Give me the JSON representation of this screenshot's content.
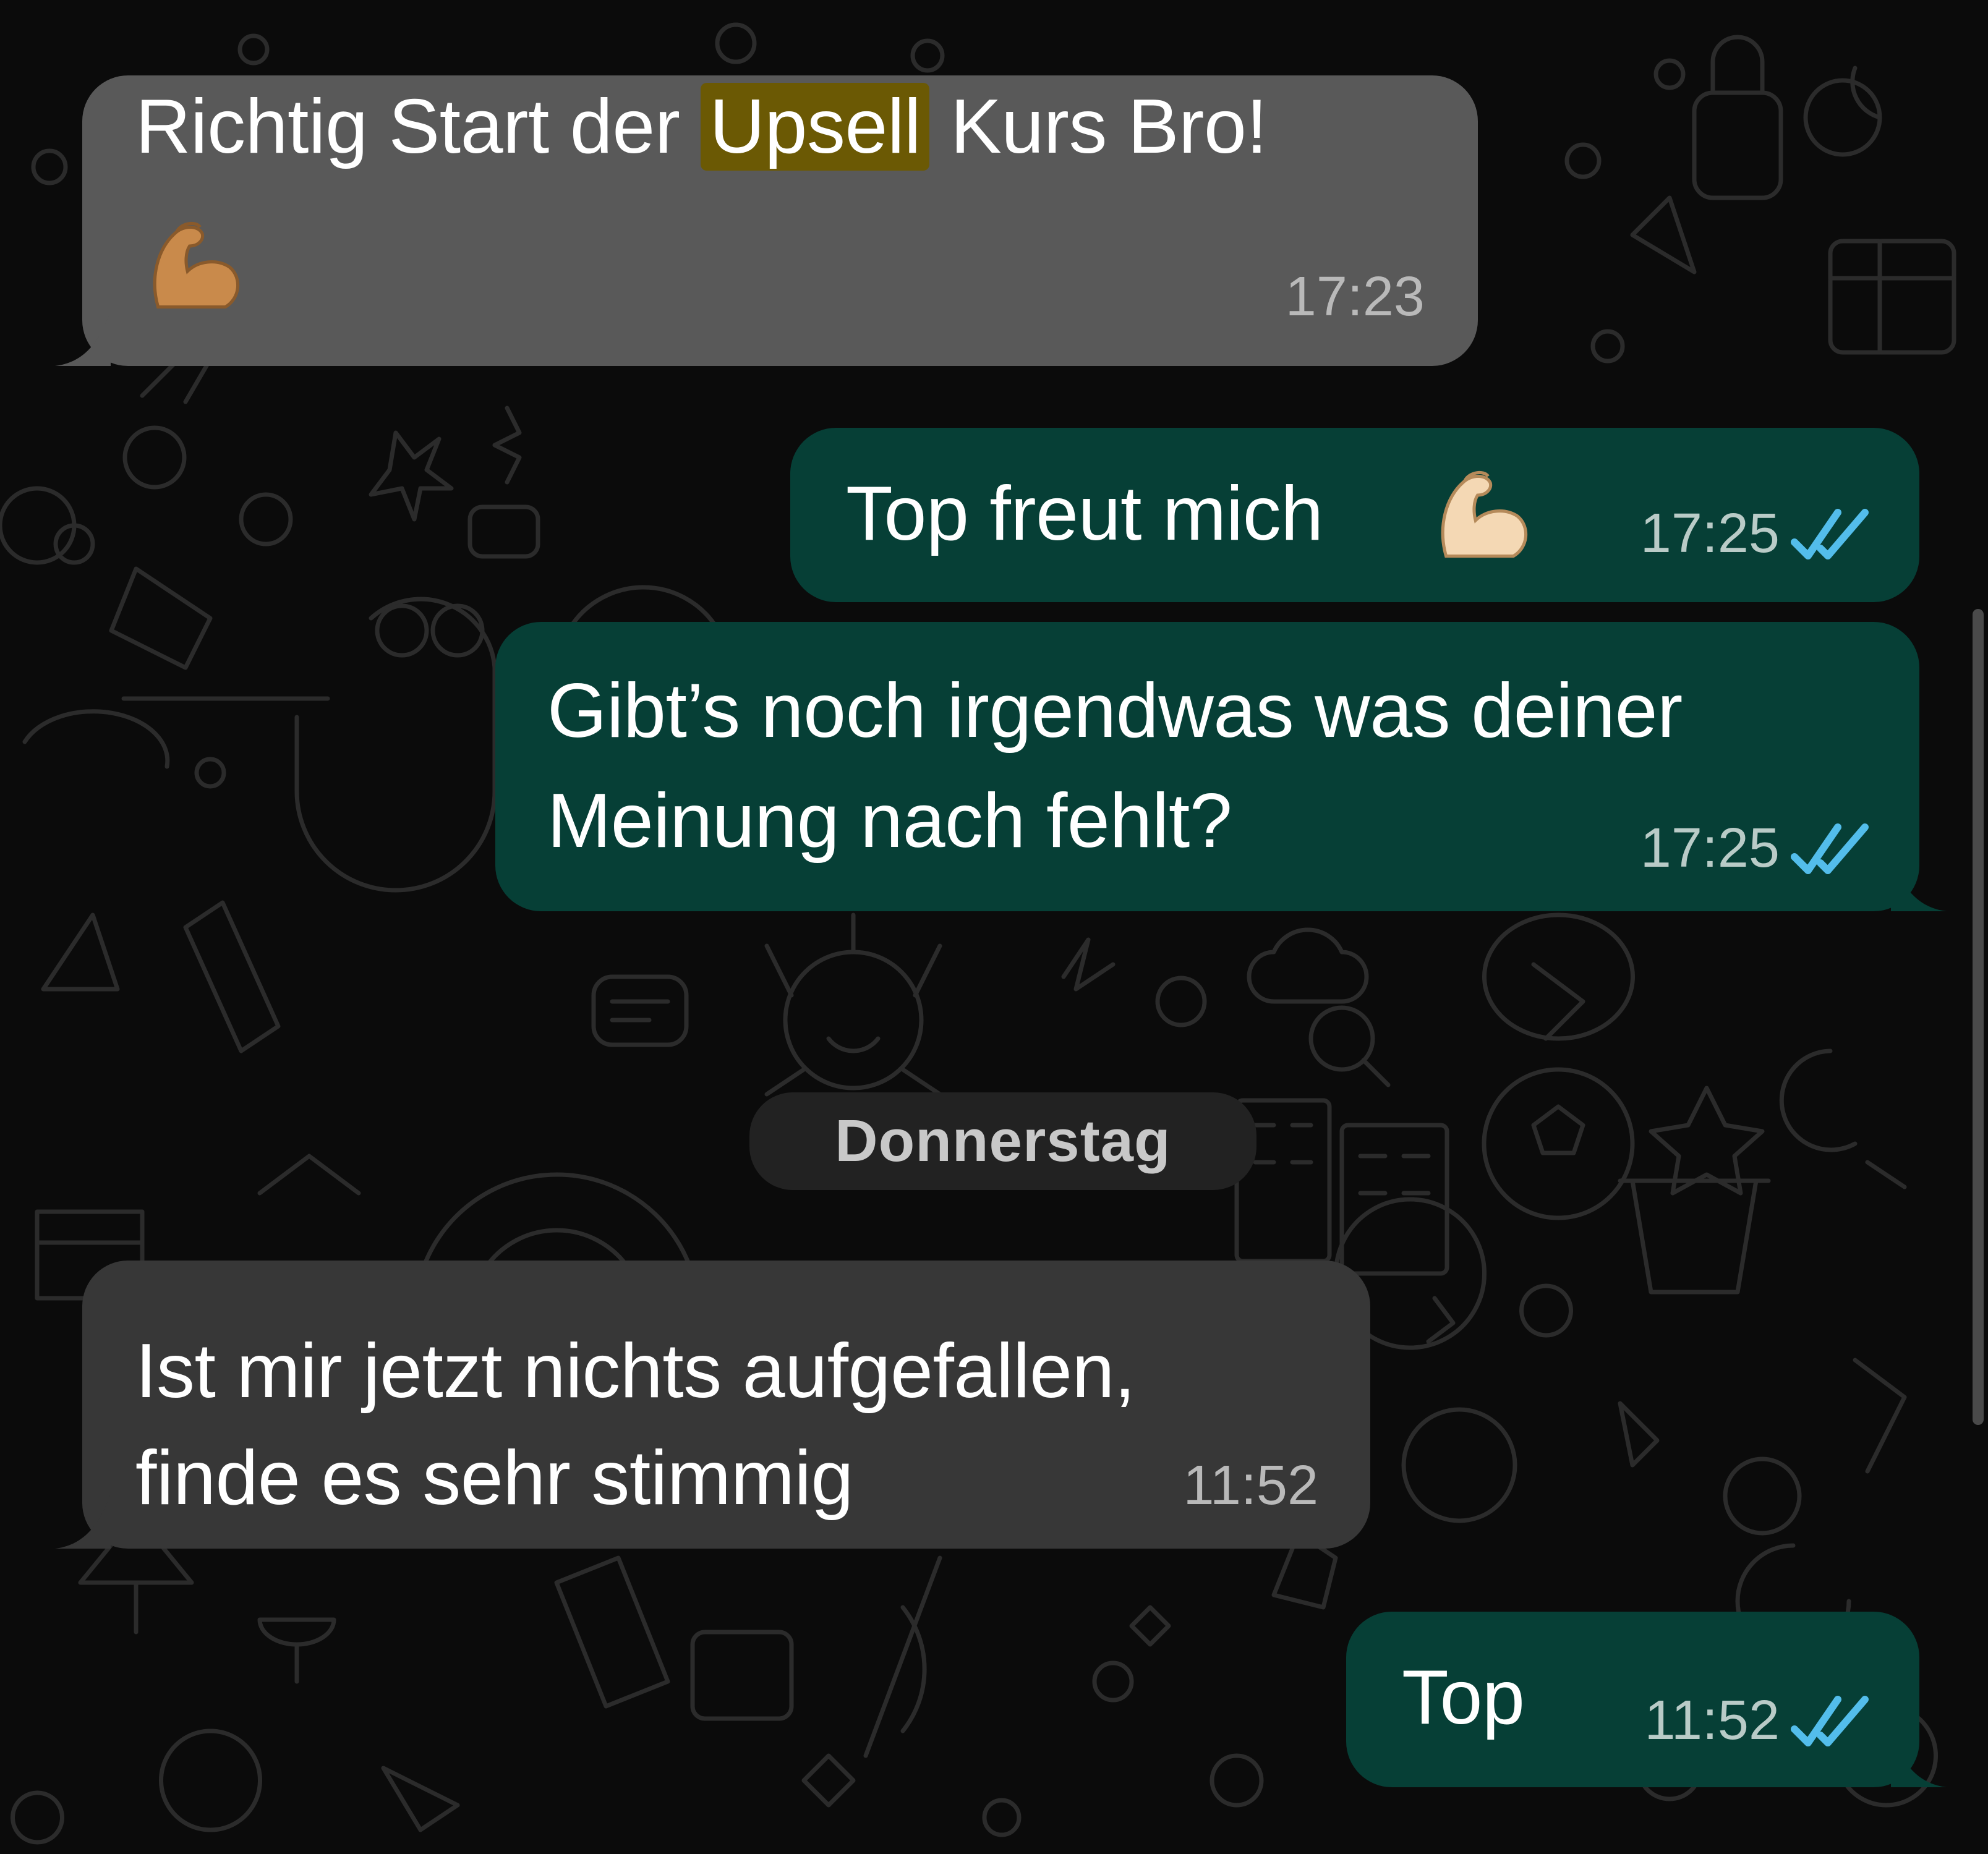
{
  "chat": {
    "messages": [
      {
        "direction": "incoming",
        "text_before": "Richtig Start der ",
        "highlight": "Upsell",
        "text_after": " Kurs Bro!",
        "emoji": "flexed-biceps-medium-skin",
        "time": "17:23"
      },
      {
        "direction": "outgoing",
        "text": "Top freut mich",
        "emoji": "flexed-biceps-light-skin",
        "time": "17:25",
        "status": "read"
      },
      {
        "direction": "outgoing",
        "lines": [
          "Gibt’s noch irgendwas was deiner",
          "Meinung nach fehlt?"
        ],
        "time": "17:25",
        "status": "read"
      },
      {
        "direction": "incoming",
        "lines": [
          "Ist mir jetzt nichts aufgefallen,",
          "finde es sehr stimmig"
        ],
        "time": "11:52"
      },
      {
        "direction": "outgoing",
        "text": "Top",
        "time": "11:52",
        "status": "read"
      }
    ],
    "date_separator": "Donnerstag"
  },
  "colors": {
    "background": "#0b0b0b",
    "incoming_bubble": "#373737",
    "incoming_bubble_highlighted": "#595959",
    "outgoing_bubble": "#063f36",
    "read_ticks": "#53bdeb",
    "search_highlight": "#6b5904"
  }
}
